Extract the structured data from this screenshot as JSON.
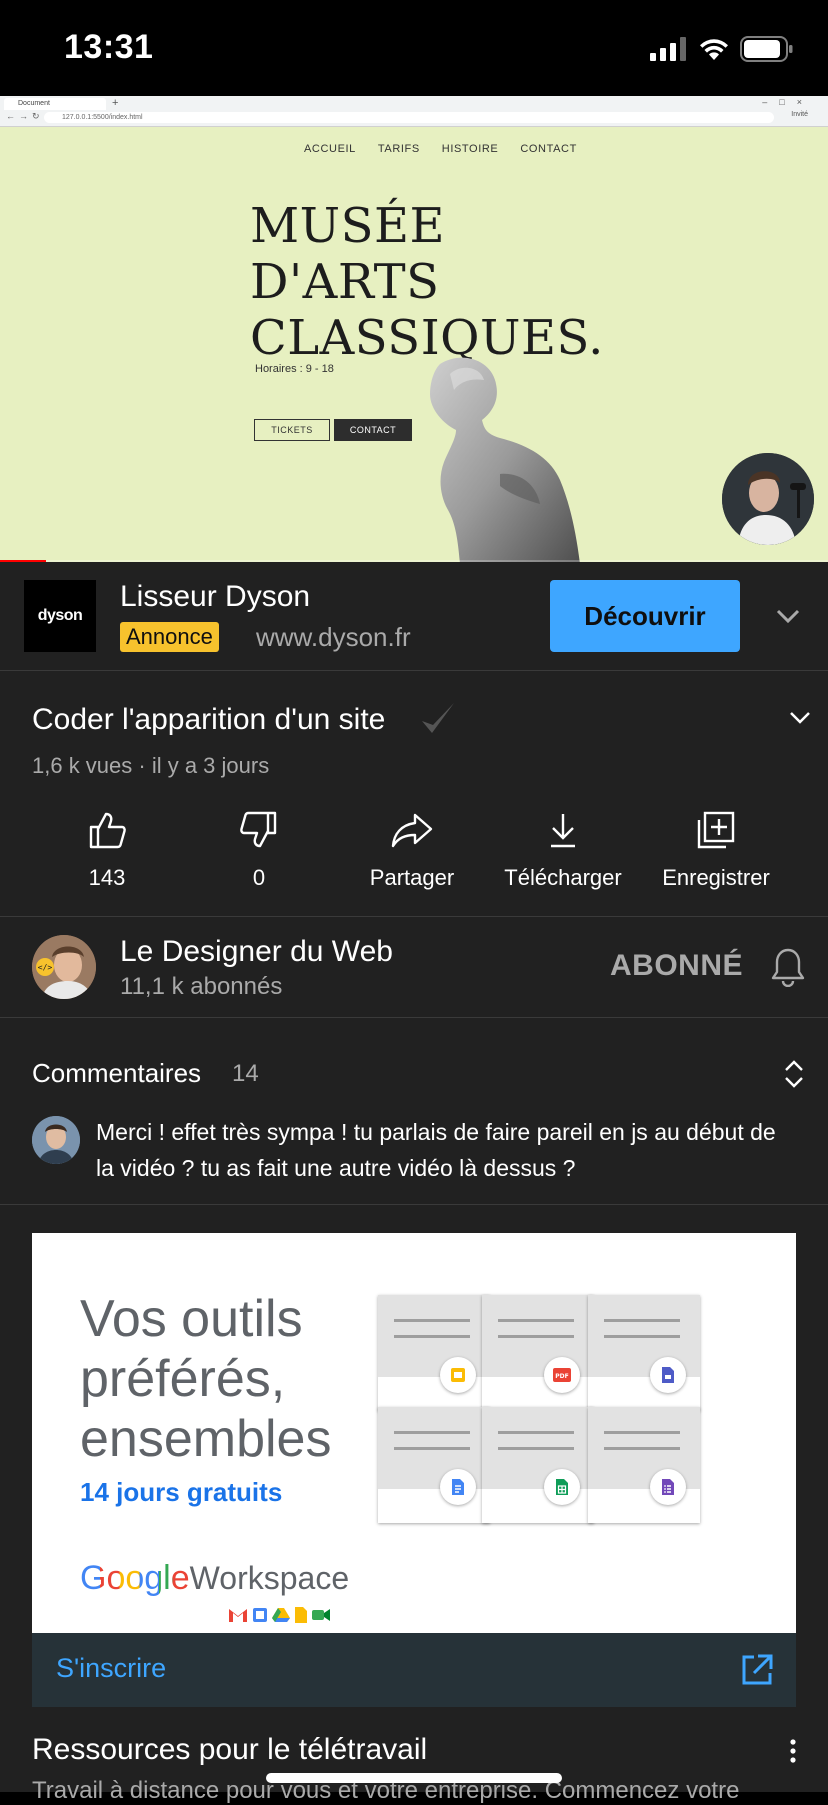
{
  "status_bar": {
    "time": "13:31"
  },
  "video": {
    "browser": {
      "tab_title": "Document",
      "url": "127.0.0.1:5500/index.html",
      "profile": "Invité"
    },
    "site_nav": [
      "ACCUEIL",
      "TARIFS",
      "HISTOIRE",
      "CONTACT"
    ],
    "site_title": [
      "MUSÉE",
      "D'ARTS",
      "CLASSIQUES."
    ],
    "site_hours": "Horaires : 9 - 18",
    "tickets_label": "TICKETS",
    "contact_label": "CONTACT",
    "progress": 0.055
  },
  "ad": {
    "logo_text": "dyson",
    "title": "Lisseur Dyson",
    "badge": "Annonce",
    "url": "www.dyson.fr",
    "cta": "Découvrir"
  },
  "video_info": {
    "title": "Coder l'apparition d'un site",
    "meta": "1,6 k vues · il y a 3 jours",
    "actions": [
      {
        "label": "143",
        "icon": "thumbs-up-icon"
      },
      {
        "label": "0",
        "icon": "thumbs-down-icon"
      },
      {
        "label": "Partager",
        "icon": "share-icon"
      },
      {
        "label": "Télécharger",
        "icon": "download-icon"
      },
      {
        "label": "Enregistrer",
        "icon": "save-to-playlist-icon"
      }
    ]
  },
  "channel": {
    "name": "Le Designer du Web",
    "subscribers": "11,1 k abonnés",
    "subscribe_label": "ABONNÉ"
  },
  "comments": {
    "title": "Commentaires",
    "count": "14",
    "top_comment": "Merci ! effet très sympa ! tu parlais de faire pareil en js au début de la vidéo ? tu as fait une autre vidéo là dessus ?"
  },
  "google_ad": {
    "headline": [
      "Vos outils",
      "préférés,",
      "ensembles"
    ],
    "offer": "14 jours gratuits",
    "brand_google": "Google",
    "brand_product": "Workspace",
    "cta": "S'inscrire",
    "title": "Ressources pour le télétravail",
    "description": "Travail à distance pour vous et votre entreprise. Commencez votre"
  },
  "colors": {
    "background": "#212121",
    "accent_blue": "#3ea6ff",
    "ad_badge": "#f7c22d",
    "progress_red": "#ff0000",
    "video_background": "#e7f0c1"
  }
}
